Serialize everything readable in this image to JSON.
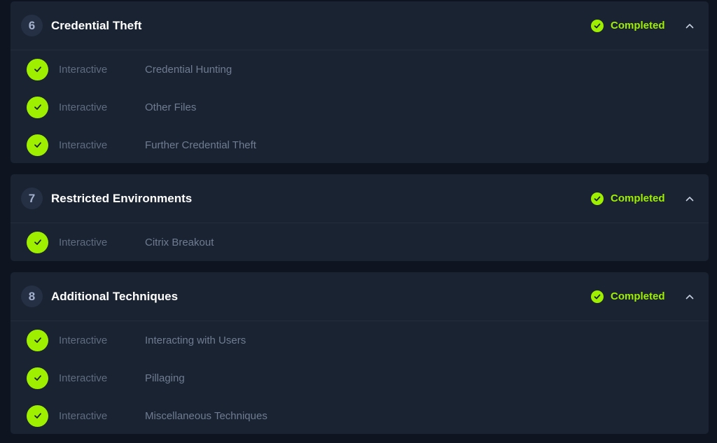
{
  "sections": [
    {
      "number": "6",
      "title": "Credential Theft",
      "status": "Completed",
      "rows": [
        {
          "type": "Interactive",
          "name": "Credential Hunting"
        },
        {
          "type": "Interactive",
          "name": "Other Files"
        },
        {
          "type": "Interactive",
          "name": "Further Credential Theft"
        }
      ]
    },
    {
      "number": "7",
      "title": "Restricted Environments",
      "status": "Completed",
      "rows": [
        {
          "type": "Interactive",
          "name": "Citrix Breakout"
        }
      ]
    },
    {
      "number": "8",
      "title": "Additional Techniques",
      "status": "Completed",
      "rows": [
        {
          "type": "Interactive",
          "name": "Interacting with Users"
        },
        {
          "type": "Interactive",
          "name": "Pillaging"
        },
        {
          "type": "Interactive",
          "name": "Miscellaneous Techniques"
        }
      ]
    }
  ],
  "colors": {
    "accent": "#9fef00",
    "panel": "#1a2332",
    "background": "#0f1520"
  },
  "icons": {
    "status": "check-circle-icon",
    "row": "check-circle-icon",
    "toggle": "chevron-up-icon"
  }
}
